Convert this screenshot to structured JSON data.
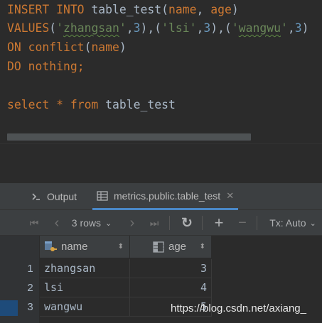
{
  "editor": {
    "lines": [
      {
        "tokens": [
          {
            "t": "INSERT ",
            "c": "kw"
          },
          {
            "t": "INTO ",
            "c": "kw"
          },
          {
            "t": "table_test",
            "c": "ident"
          },
          {
            "t": "(",
            "c": "ident"
          },
          {
            "t": "name",
            "c": "kw"
          },
          {
            "t": ", ",
            "c": "ident"
          },
          {
            "t": "age",
            "c": "kw"
          },
          {
            "t": ")",
            "c": "ident"
          }
        ]
      },
      {
        "tokens": [
          {
            "t": "VALUES",
            "c": "kw"
          },
          {
            "t": "(",
            "c": "ident"
          },
          {
            "t": "'",
            "c": "str"
          },
          {
            "t": "zhangsan",
            "c": "str squiggle"
          },
          {
            "t": "'",
            "c": "str"
          },
          {
            "t": ",",
            "c": "ident"
          },
          {
            "t": "3",
            "c": "num"
          },
          {
            "t": "),(",
            "c": "ident"
          },
          {
            "t": "'lsi'",
            "c": "str"
          },
          {
            "t": ",",
            "c": "ident"
          },
          {
            "t": "3",
            "c": "num"
          },
          {
            "t": "),(",
            "c": "ident"
          },
          {
            "t": "'",
            "c": "str"
          },
          {
            "t": "wangwu",
            "c": "str squiggle"
          },
          {
            "t": "'",
            "c": "str"
          },
          {
            "t": ",",
            "c": "ident"
          },
          {
            "t": "3",
            "c": "num"
          },
          {
            "t": ")",
            "c": "ident"
          }
        ]
      },
      {
        "tokens": [
          {
            "t": "ON ",
            "c": "kw"
          },
          {
            "t": "conflict",
            "c": "kw"
          },
          {
            "t": "(",
            "c": "ident"
          },
          {
            "t": "name",
            "c": "kw"
          },
          {
            "t": ")",
            "c": "ident"
          }
        ]
      },
      {
        "tokens": [
          {
            "t": "DO ",
            "c": "kw"
          },
          {
            "t": "nothing",
            "c": "kw"
          },
          {
            "t": ";",
            "c": "kw"
          }
        ]
      },
      {
        "tokens": []
      },
      {
        "tokens": [
          {
            "t": "select ",
            "c": "kw"
          },
          {
            "t": "* ",
            "c": "kw"
          },
          {
            "t": "from ",
            "c": "kw"
          },
          {
            "t": "table_test",
            "c": "ident"
          }
        ]
      }
    ]
  },
  "tabs": [
    {
      "label": "Output",
      "icon": "console-icon"
    },
    {
      "label": "metrics.public.table_test",
      "icon": "table-icon",
      "close": "✕"
    }
  ],
  "toolbar": {
    "first": "⏮",
    "prev": "‹",
    "rows_label": "3 rows",
    "rows_caret": "⌄",
    "next": "›",
    "last": "⏭",
    "refresh": "↻",
    "add": "+",
    "remove": "−",
    "tx_label": "Tx: Auto",
    "tx_caret": "⌄"
  },
  "grid": {
    "columns": [
      {
        "name": "name",
        "icon": "key-column-icon",
        "sort": "⬍"
      },
      {
        "name": "age",
        "icon": "column-icon",
        "sort": "⬍"
      }
    ],
    "rows": [
      {
        "num": "1",
        "name": "zhangsan",
        "age": "3"
      },
      {
        "num": "2",
        "name": "lsi",
        "age": "4"
      },
      {
        "num": "3",
        "name": "wangwu",
        "age": "5"
      }
    ]
  },
  "watermark": "https://blog.csdn.net/axiang_",
  "colors": {
    "keyword": "#cc7832",
    "string": "#6a8759",
    "number": "#6897bb",
    "text": "#a9b7c6",
    "accent": "#4a88c7"
  }
}
